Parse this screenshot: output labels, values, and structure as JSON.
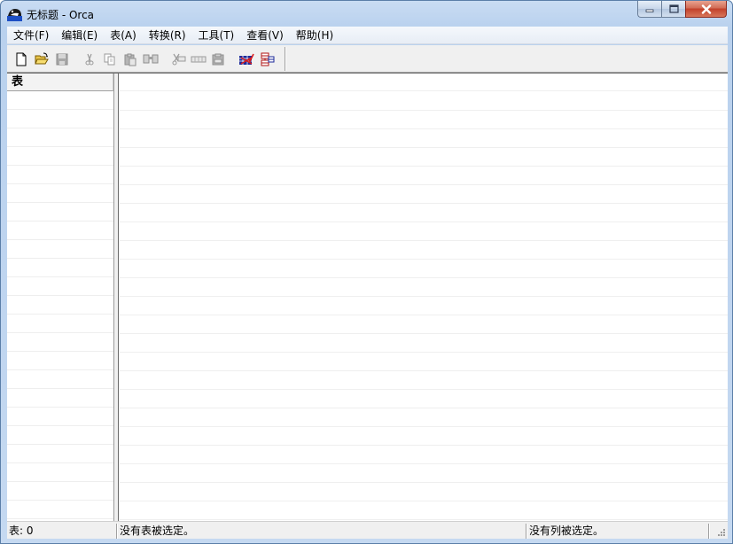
{
  "window": {
    "title": "无标题 - Orca"
  },
  "menu": {
    "items": [
      "文件(F)",
      "编辑(E)",
      "表(A)",
      "转换(R)",
      "工具(T)",
      "查看(V)",
      "帮助(H)"
    ]
  },
  "toolbar": {
    "buttons": [
      {
        "icon": "new-file-icon",
        "enabled": true
      },
      {
        "icon": "open-folder-icon",
        "enabled": true
      },
      {
        "icon": "save-icon",
        "enabled": false
      },
      {
        "icon": "cut-icon",
        "enabled": false
      },
      {
        "icon": "copy-icon",
        "enabled": false
      },
      {
        "icon": "paste-icon",
        "enabled": false
      },
      {
        "icon": "find-icon",
        "enabled": false
      },
      {
        "icon": "cut-row-icon",
        "enabled": false
      },
      {
        "icon": "copy-row-icon",
        "enabled": false
      },
      {
        "icon": "paste-row-icon",
        "enabled": false
      },
      {
        "icon": "validate-icon",
        "enabled": true
      },
      {
        "icon": "merge-module-icon",
        "enabled": true
      }
    ]
  },
  "left_pane": {
    "header": "表"
  },
  "status": {
    "table_count": "表: 0",
    "table_selection": "没有表被选定。",
    "column_selection": "没有列被选定。"
  },
  "colors": {
    "titlebar": "#b9d1ee",
    "close_button": "#c2402a",
    "grid_line": "#eeeeee"
  }
}
